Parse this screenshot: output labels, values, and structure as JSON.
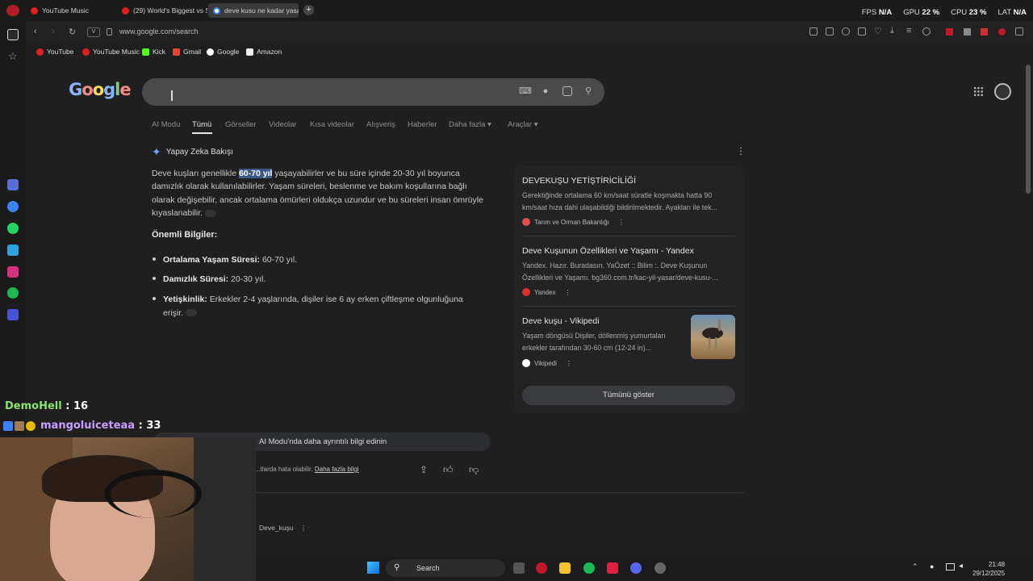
{
  "browser": {
    "tabs": [
      {
        "label": "YouTube Music"
      },
      {
        "label": "(29) World's Biggest vs Sm"
      },
      {
        "label": "deve kusu ne kadar yasar"
      }
    ],
    "url": "www.google.com/search",
    "bookmarks": [
      "YouTube",
      "YouTube Music",
      "Kick",
      "Gmail",
      "Google",
      "Amazon"
    ],
    "address_chip": "V"
  },
  "stats": {
    "fps_label": "FPS",
    "fps_value": "N/A",
    "gpu_label": "GPU",
    "gpu_value": "22 %",
    "cpu_label": "CPU",
    "cpu_value": "23 %",
    "lat_label": "LAT",
    "lat_value": "N/A"
  },
  "google": {
    "logo": "Google",
    "tabs": [
      "AI Modu",
      "Tümü",
      "Görseller",
      "Videolar",
      "Kısa videolar",
      "Alışveriş",
      "Haberler",
      "Daha fazla ▾",
      "Araçlar ▾"
    ],
    "active_tab": "Tümü"
  },
  "ai_overview": {
    "header": "Yapay Zeka Bakışı",
    "para_pre": "Deve kuşları genellikle ",
    "para_highlight": "60-70 yıl",
    "para_post": " yaşayabilirler ve bu süre içinde 20-30 yıl boyunca damızlık olarak kullanılabilirler. Yaşam süreleri, beslenme ve bakım koşullarına bağlı olarak değişebilir, ancak ortalama ömürleri oldukça uzundur ve bu süreleri insan ömrüyle kıyaslanabilir.",
    "important_heading": "Önemli Bilgiler:",
    "bullets": [
      {
        "label": "Ortalama Yaşam Süresi:",
        "text": " 60-70 yıl."
      },
      {
        "label": "Damızlık Süresi:",
        "text": " 20-30 yıl."
      },
      {
        "label": "Yetişkinlik:",
        "text": " Erkekler 2-4 yaşlarında, dişiler ise 6 ay erken çiftleşme olgunluğuna erişir."
      }
    ],
    "ai_mode_prompt": "AI Modu'nda daha ayrıntılı bilgi edinin",
    "disclaimer": "...tlarda hata olabilir.",
    "disclaimer_link": "Daha fazla bilgi"
  },
  "sources": [
    {
      "title": "DEVEKUŞU YETİŞTİRİCİLİĞİ",
      "desc": "Gerektiğinde ortalama 60 km/saat süratle koşmakta hatta 90 km/saat hıza dahi ulaşabildiği bildirilmektedir. Ayakları ile tek...",
      "source": "Tarım ve Orman Bakanlığı"
    },
    {
      "title": "Deve Kuşunun Özellikleri ve Yaşamı - Yandex",
      "desc": "Yandex. Hazır. Buradasın. YaÖzet :; Bilim :. Deve Kuşunun Özellikleri ve Yaşamı. bg360.com.tr/kac-yil-yasar/deve-kusu-...",
      "source": "Yandex"
    },
    {
      "title": "Deve kuşu - Vikipedi",
      "desc": "Yaşam döngüsü Dişiler, döllenmiş yumurtaları erkekler tarafından 30-60 cm (12-24 in)...",
      "source": "Vikipedi"
    }
  ],
  "show_all": "Tümünü göster",
  "wiki_result": "Deve_kuşu",
  "chat": [
    {
      "user": "DemoHell",
      "count": ": 16",
      "color": "#8be36b"
    },
    {
      "user": "mangoluiceteaa",
      "count": ": 33",
      "color": "#c8a0ff"
    }
  ],
  "taskbar": {
    "search": "Search",
    "time": "21:48",
    "date": "29/12/2025"
  }
}
